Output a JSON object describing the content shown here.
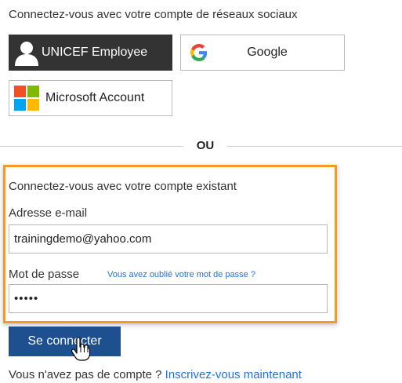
{
  "social": {
    "title": "Connectez-vous avec votre compte de réseaux sociaux",
    "unicef_label": "UNICEF Employee",
    "google_label": "Google",
    "microsoft_label": "Microsoft Account"
  },
  "divider": {
    "text": "OU"
  },
  "local": {
    "title": "Connectez-vous avec votre compte existant",
    "email_label": "Adresse e-mail",
    "email_value": "trainingdemo@yahoo.com",
    "password_label": "Mot de passe",
    "forgot_link": "Vous avez oublié votre mot de passe ?",
    "password_value": "•••••",
    "submit_label": "Se connecter"
  },
  "signup": {
    "prompt": "Vous n'avez pas de compte ? ",
    "link": "Inscrivez-vous maintenant"
  },
  "colors": {
    "highlight": "#f59a23",
    "primary_button": "#1e4f8f",
    "link": "#1a73e8",
    "unicef_button": "#333333"
  },
  "icons": {
    "unicef": "user-avatar-icon",
    "google": "google-logo-icon",
    "microsoft": "microsoft-logo-icon",
    "cursor": "hand-pointer-cursor-icon"
  }
}
